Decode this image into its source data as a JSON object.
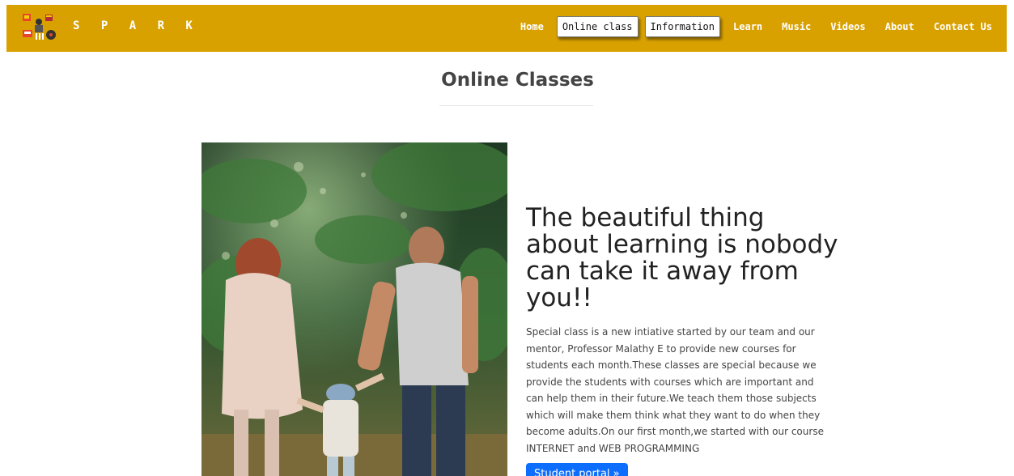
{
  "header": {
    "brand": "S P A R K",
    "logo_icon": "spark-logo-icon",
    "nav": [
      {
        "label": "Home",
        "boxed": false
      },
      {
        "label": "Online class",
        "boxed": true
      },
      {
        "label": "Information",
        "boxed": true
      },
      {
        "label": "Learn",
        "boxed": false
      },
      {
        "label": "Music",
        "boxed": false
      },
      {
        "label": "Videos",
        "boxed": false
      },
      {
        "label": "About",
        "boxed": false
      },
      {
        "label": "Contact Us",
        "boxed": false
      }
    ],
    "colors": {
      "bar": "#d9a100",
      "text": "#ffffff"
    }
  },
  "main": {
    "title": "Online Classes",
    "headline": "The beautiful thing about learning is nobody can take it away from you!!",
    "description": "Special class is a new intiative started by our team and our mentor, Professor Malathy E to provide new courses for students each month.These classes are special because we provide the students with courses which are important and can help them in their future.We teach them those subjects which will make them think what they want to do when they become adults.On our first month,we started with our course INTERNET and WEB PROGRAMMING",
    "button_label": "Student portal »",
    "colors": {
      "button": "#0d6efd"
    }
  }
}
